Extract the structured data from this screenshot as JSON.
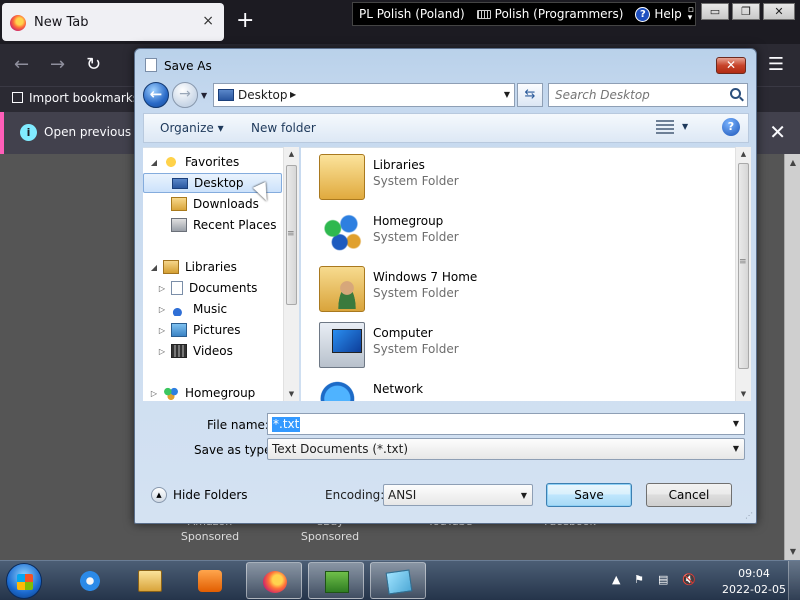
{
  "browser": {
    "tab_title": "New Tab",
    "tab_close": "×",
    "new_tab": "+",
    "back": "←",
    "forward": "→",
    "reload": "↻",
    "menu": "☰",
    "bookmark_import": "Import bookmarks...",
    "infobar_text": "Open previous",
    "infobar_close": "✕",
    "tiles": [
      {
        "name": "Amazon",
        "sub": "Sponsored"
      },
      {
        "name": "eBay",
        "sub": "Sponsored"
      },
      {
        "name": "YouTube",
        "sub": ""
      },
      {
        "name": "Facebook",
        "sub": ""
      }
    ]
  },
  "language_bar": {
    "input_lang": "PL Polish (Poland)",
    "keyboard": "Polish (Programmers)",
    "help": "Help"
  },
  "window_controls": {
    "minimize": "▭",
    "restore": "❐",
    "close": "✕"
  },
  "dialog": {
    "title": "Save As",
    "close": "✕",
    "address": {
      "current": "Desktop",
      "separator": "▶"
    },
    "search_placeholder": "Search Desktop",
    "toolbar": {
      "organize": "Organize ▾",
      "new_folder": "New folder",
      "help": "?"
    },
    "nav_tree": [
      {
        "label": "Favorites",
        "icon": "star-icon",
        "twisty": "◢",
        "selected": false
      },
      {
        "label": "Desktop",
        "icon": "desktop-icon",
        "twisty": "",
        "selected": true
      },
      {
        "label": "Downloads",
        "icon": "downloads-icon",
        "twisty": "",
        "selected": false
      },
      {
        "label": "Recent Places",
        "icon": "recent-places-icon",
        "twisty": "",
        "selected": false
      },
      {
        "label": "Libraries",
        "icon": "libraries-icon",
        "twisty": "◢",
        "selected": false
      },
      {
        "label": "Documents",
        "icon": "documents-icon",
        "twisty": "▷",
        "selected": false
      },
      {
        "label": "Music",
        "icon": "music-icon",
        "twisty": "▷",
        "selected": false
      },
      {
        "label": "Pictures",
        "icon": "pictures-icon",
        "twisty": "▷",
        "selected": false
      },
      {
        "label": "Videos",
        "icon": "videos-icon",
        "twisty": "▷",
        "selected": false
      },
      {
        "label": "Homegroup",
        "icon": "homegroup-icon",
        "twisty": "▷",
        "selected": false
      }
    ],
    "files": [
      {
        "name": "Libraries",
        "type": "System Folder",
        "icon": "libraries-folder-icon"
      },
      {
        "name": "Homegroup",
        "type": "System Folder",
        "icon": "homegroup-icon"
      },
      {
        "name": "Windows 7 Home",
        "type": "System Folder",
        "icon": "user-folder-icon"
      },
      {
        "name": "Computer",
        "type": "System Folder",
        "icon": "computer-icon"
      },
      {
        "name": "Network",
        "type": "",
        "icon": "network-icon"
      }
    ],
    "file_name_label": "File name:",
    "file_name_value": "*.txt",
    "save_type_label": "Save as type:",
    "save_type_value": "Text Documents (*.txt)",
    "hide_folders": "Hide Folders",
    "encoding_label": "Encoding:",
    "encoding_value": "ANSI",
    "save_button": "Save",
    "cancel_button": "Cancel"
  },
  "taskbar": {
    "clock_time": "09:04",
    "clock_date": "2022-02-05"
  }
}
